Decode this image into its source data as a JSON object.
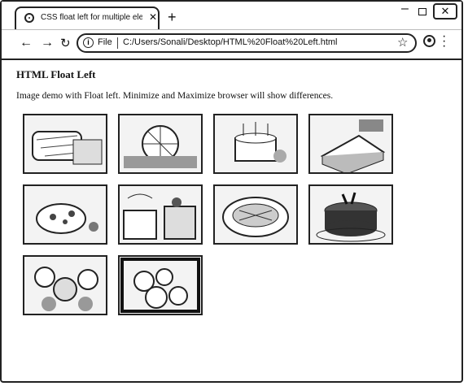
{
  "tab": {
    "title": "CSS float left for multiple elemen"
  },
  "omnibox": {
    "file_label": "File",
    "url": "C:/Users/Sonali/Desktop/HTML%20Float%20Left.html"
  },
  "page": {
    "heading": "HTML Float Left",
    "description": "Image demo with Float left. Minimize and Maximize browser will show differences."
  },
  "icons": {
    "favicon": "chrome-favicon-icon",
    "close_tab": "close-icon",
    "new_tab": "plus-icon",
    "back": "arrow-left-icon",
    "forward": "arrow-right-icon",
    "reload": "reload-icon",
    "info": "info-icon",
    "star": "star-icon",
    "profile": "profile-icon",
    "menu": "kebab-menu-icon"
  },
  "images": [
    {
      "name": "bread-loaf-image"
    },
    {
      "name": "cake-slices-image"
    },
    {
      "name": "birthday-cake-image"
    },
    {
      "name": "cake-slice-image"
    },
    {
      "name": "cookie-plate-image"
    },
    {
      "name": "cupcakes-image"
    },
    {
      "name": "pie-image"
    },
    {
      "name": "chocolate-cake-image"
    },
    {
      "name": "fruit-pastries-image"
    },
    {
      "name": "fruit-basket-image"
    }
  ]
}
